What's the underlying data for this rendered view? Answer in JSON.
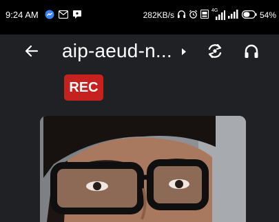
{
  "status_bar": {
    "time": "9:24 AM",
    "speed": "282KB/s",
    "network_label": "4G",
    "battery": "54%"
  },
  "app_bar": {
    "title": "aip-aeud-n..."
  },
  "rec_badge": {
    "label": "REC",
    "color": "#c5221f"
  },
  "icons": {
    "back": "arrow-left-icon",
    "switch_camera": "camera-switch-icon",
    "audio": "headphones-icon"
  }
}
